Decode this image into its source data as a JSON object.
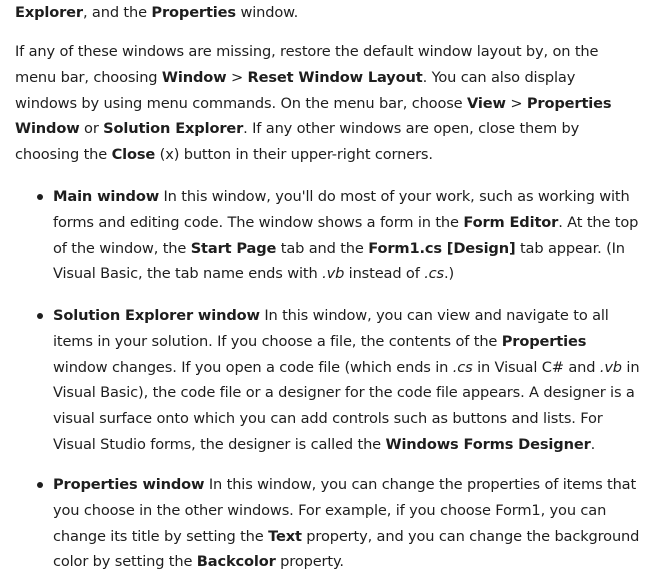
{
  "intro": {
    "s1": "Explorer",
    "s2": ", and the ",
    "s3": "Properties",
    "s4": " window."
  },
  "para": {
    "t1": "If any of these windows are missing, restore the default window layout by, on the menu bar, choosing ",
    "t2": "Window",
    "t3": " > ",
    "t4": "Reset Window Layout",
    "t5": ". You can also display windows by using menu commands. On the menu bar, choose ",
    "t6": "View",
    "t7": " > ",
    "t8": "Properties Window",
    "t9": " or ",
    "t10": "Solution Explorer",
    "t11": ". If any other windows are open, close them by choosing the ",
    "t12": "Close",
    "t13": " (x) button in their upper-right corners."
  },
  "bullets": [
    {
      "title": "Main window",
      "t1": " In this window, you'll do most of your work, such as working with forms and editing code. The window shows a form in the ",
      "t2": "Form Editor",
      "t3": ". At the top of the window, the ",
      "t4": "Start Page",
      "t5": " tab and the ",
      "t6": "Form1.cs [Design]",
      "t7": " tab appear. (In Visual Basic, the tab name ends with ",
      "t8": ".vb",
      "t9": " instead of ",
      "t10": ".cs",
      "t11": ".)"
    },
    {
      "title": "Solution Explorer window",
      "t1": " In this window, you can view and navigate to all items in your solution. If you choose a file, the contents of the ",
      "t2": "Properties",
      "t3": " window changes. If you open a code file (which ends in ",
      "t4": ".cs",
      "t5": " in Visual C# and ",
      "t6": ".vb",
      "t7": " in Visual Basic), the code file or a designer for the code file appears. A designer is a visual surface onto which you can add controls such as buttons and lists. For Visual Studio forms, the designer is called the ",
      "t8": "Windows Forms Designer",
      "t9": "."
    },
    {
      "title": "Properties window",
      "t1": " In this window, you can change the properties of items that you choose in the other windows. For example, if you choose Form1, you can change its title by setting the ",
      "t2": "Text",
      "t3": " property, and you can change the background color by setting the ",
      "t4": "Backcolor",
      "t5": " property."
    }
  ]
}
